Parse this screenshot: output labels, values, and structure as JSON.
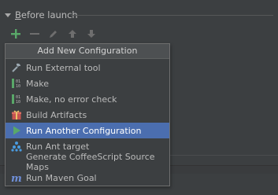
{
  "section": {
    "title_mnemonic": "B",
    "title_rest": "efore launch"
  },
  "toolbar": {
    "add_icon": "plus-icon",
    "remove_icon": "minus-icon",
    "edit_icon": "pencil-icon",
    "move_up_icon": "arrow-up-icon",
    "move_down_icon": "arrow-down-icon"
  },
  "popup": {
    "title": "Add New Configuration",
    "items": [
      {
        "label": "Run External tool",
        "icon": "external-tool-icon",
        "selected": false
      },
      {
        "label": "Make",
        "icon": "make-icon",
        "selected": false
      },
      {
        "label": "Make, no error check",
        "icon": "make-no-error-check-icon",
        "selected": false
      },
      {
        "label": "Build Artifacts",
        "icon": "build-artifacts-icon",
        "selected": false
      },
      {
        "label": "Run Another Configuration",
        "icon": "run-icon",
        "selected": true
      },
      {
        "label": "Run Ant target",
        "icon": "ant-icon",
        "selected": false
      },
      {
        "label": "Generate CoffeeScript Source Maps",
        "icon": "",
        "selected": false
      },
      {
        "label": "Run Maven Goal",
        "icon": "maven-icon",
        "selected": false
      }
    ]
  },
  "colors": {
    "background": "#3c3f41",
    "selection": "#4b6eaf",
    "add_green": "#59a869",
    "text": "#bbbbbb"
  }
}
